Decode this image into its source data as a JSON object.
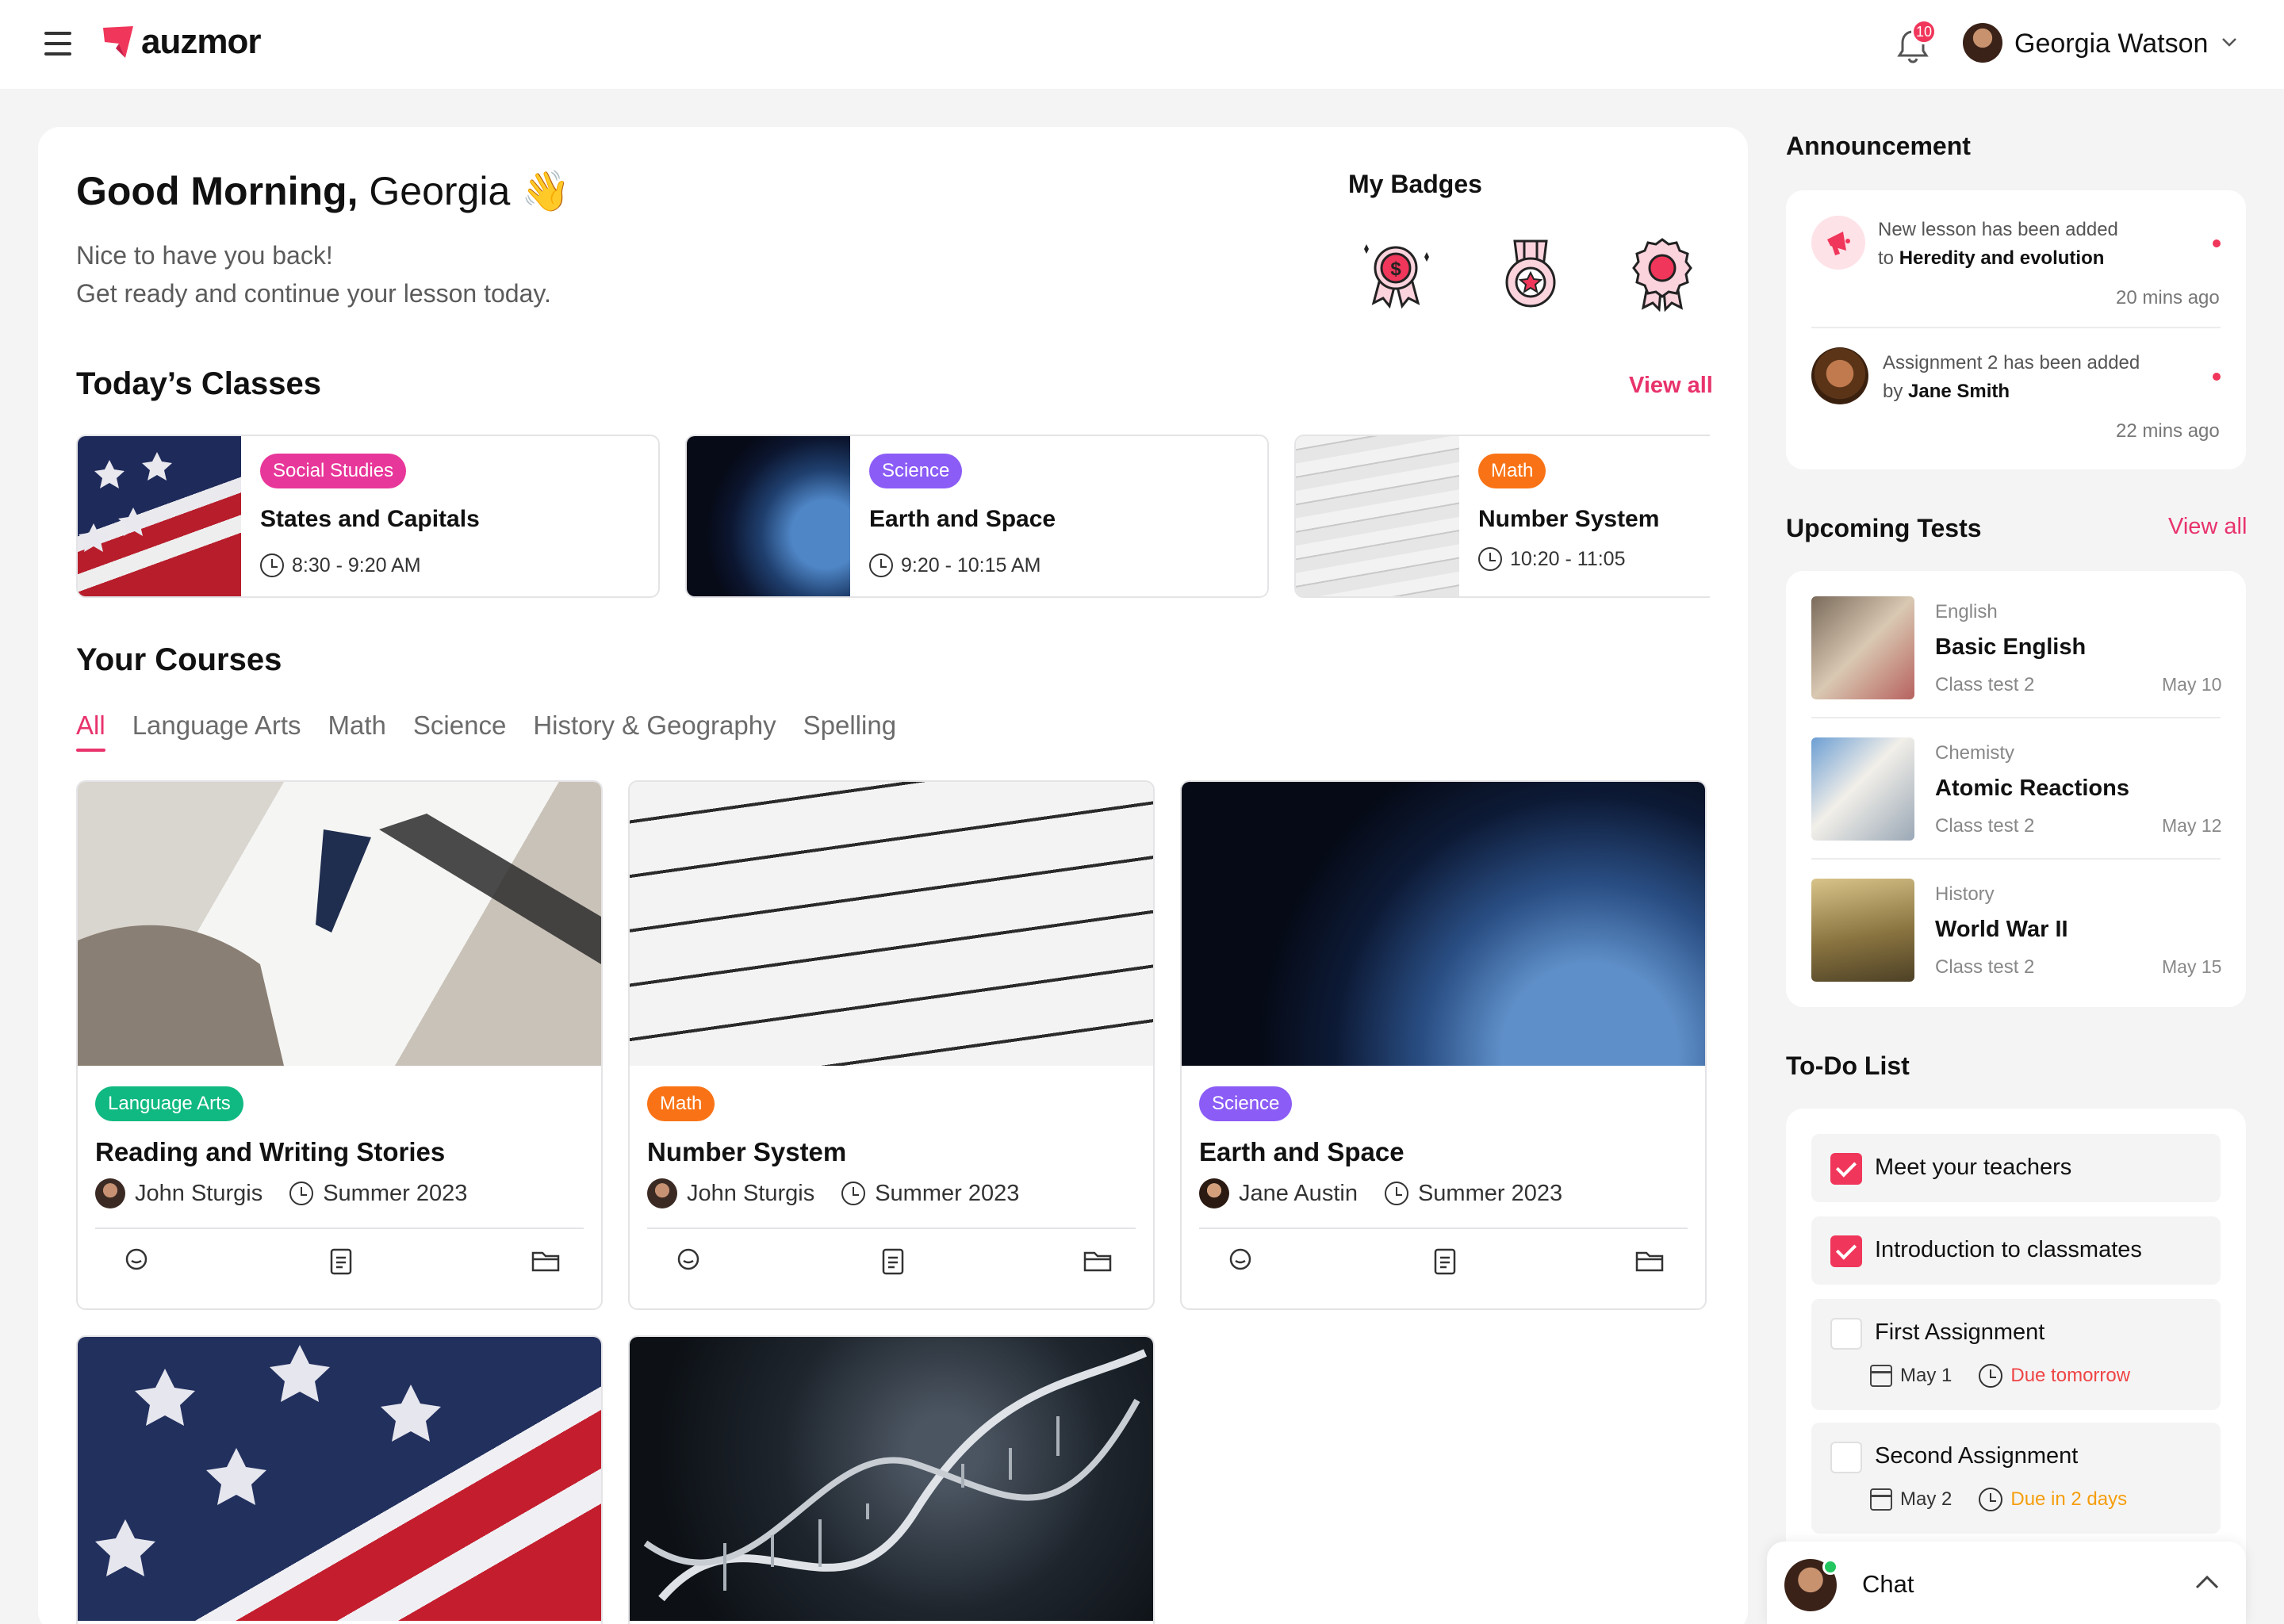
{
  "header": {
    "brand": "auzmor",
    "notifications": "10",
    "user_name": "Georgia Watson"
  },
  "greeting": {
    "hello": "Good Morning,",
    "name": "Georgia",
    "wave": "👋",
    "line1": "Nice to have you back!",
    "line2": "Get ready and continue your lesson today."
  },
  "badges": {
    "title": "My Badges"
  },
  "todays_classes": {
    "title": "Today’s Classes",
    "view_all": "View all",
    "items": [
      {
        "tag": "Social Studies",
        "tag_color": "#e8379a",
        "title": "States and Capitals",
        "time": "8:30 - 9:20 AM"
      },
      {
        "tag": "Science",
        "tag_color": "#8b5cf6",
        "title": "Earth and Space",
        "time": "9:20 - 10:15 AM"
      },
      {
        "tag": "Math",
        "tag_color": "#f97316",
        "title": "Number System",
        "time": "10:20 - 11:05"
      }
    ]
  },
  "courses": {
    "title": "Your Courses",
    "tabs": [
      "All",
      "Language Arts",
      "Math",
      "Science",
      "History & Geography",
      "Spelling"
    ],
    "items": [
      {
        "tag": "Language Arts",
        "tag_color": "#10b981",
        "title": "Reading and Writing Stories",
        "teacher": "John Sturgis",
        "term": "Summer 2023"
      },
      {
        "tag": "Math",
        "tag_color": "#f97316",
        "title": "Number System",
        "teacher": "John Sturgis",
        "term": "Summer 2023"
      },
      {
        "tag": "Science",
        "tag_color": "#8b5cf6",
        "title": "Earth and Space",
        "teacher": "Jane Austin",
        "term": "Summer 2023"
      }
    ]
  },
  "announcement": {
    "title": "Announcement",
    "items": [
      {
        "text": "New lesson has been added",
        "prefix": "to",
        "bold": "Heredity and evolution",
        "time": "20 mins ago"
      },
      {
        "text": "Assignment 2 has been added",
        "prefix": "by",
        "bold": "Jane Smith",
        "time": "22 mins ago"
      }
    ]
  },
  "upcoming_tests": {
    "title": "Upcoming Tests",
    "view_all": "View all",
    "items": [
      {
        "category": "English",
        "name": "Basic English",
        "sub": "Class test 2",
        "date": "May 10"
      },
      {
        "category": "Chemisty",
        "name": "Atomic Reactions",
        "sub": "Class test 2",
        "date": "May 12"
      },
      {
        "category": "History",
        "name": "World War II",
        "sub": "Class test 2",
        "date": "May 15"
      }
    ]
  },
  "todo": {
    "title": "To-Do List",
    "items": [
      {
        "text": "Meet your teachers",
        "done": true
      },
      {
        "text": "Introduction to classmates",
        "done": true
      },
      {
        "text": "First Assignment",
        "done": false,
        "date": "May 1",
        "due": "Due tomorrow",
        "due_color": "#ef4444"
      },
      {
        "text": "Second Assignment",
        "done": false,
        "date": "May 2",
        "due": "Due in 2 days",
        "due_color": "#f59e0b"
      }
    ]
  },
  "chat": {
    "label": "Chat"
  }
}
